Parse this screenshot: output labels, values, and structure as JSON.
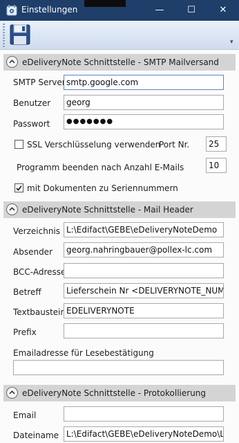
{
  "window": {
    "title": "Einstellungen",
    "min_glyph": "—",
    "max_glyph": "☐",
    "close_glyph": "✕"
  },
  "toolbar": {
    "overflow_glyph": "▾"
  },
  "smtp": {
    "header": "eDeliveryNote Schnittstelle - SMTP Mailversand",
    "server_label": "SMTP Server",
    "server_value": "smtp.google.com",
    "user_label": "Benutzer",
    "user_value": "georg",
    "password_label": "Passwort",
    "password_value": "●●●●●●●",
    "ssl_label": "SSL Verschlüsselung verwenden",
    "ssl_checked": false,
    "port_label": "Port Nr.",
    "port_value": "25",
    "quit_label": "Programm beenden nach Anzahl E-Mails",
    "quit_value": "10",
    "serial_label": "mit Dokumenten zu Seriennummern",
    "serial_checked": true
  },
  "mail_header": {
    "header": "eDeliveryNote Schnittstelle - Mail Header",
    "dir_label": "Verzeichnis",
    "dir_value": "L:\\Edifact\\GEBE\\eDeliveryNoteDemo",
    "sender_label": "Absender",
    "sender_value": "georg.nahringbauer@pollex-lc.com",
    "bcc_label": "BCC-Adresse",
    "bcc_value": "",
    "subject_label": "Betreff",
    "subject_value": "Lieferschein Nr <DELIVERYNOTE_NUMBER>",
    "text_label": "Textbaustein",
    "text_value": "EDELIVERYNOTE",
    "prefix_label": "Prefix",
    "prefix_value": "",
    "receipt_label": "Emailadresse für Lesebestätigung",
    "receipt_value": ""
  },
  "logging": {
    "header": "eDeliveryNote Schnittstelle - Protokollierung",
    "email_label": "Email",
    "email_value": "",
    "file_label": "Dateiname",
    "file_value": "L:\\Edifact\\GEBE\\eDeliveryNoteDemo\\Logging"
  },
  "colors": {
    "titlebar": "#1f3f6a",
    "section_header": "#d4d4d4",
    "focus_border": "#5b86c9"
  }
}
